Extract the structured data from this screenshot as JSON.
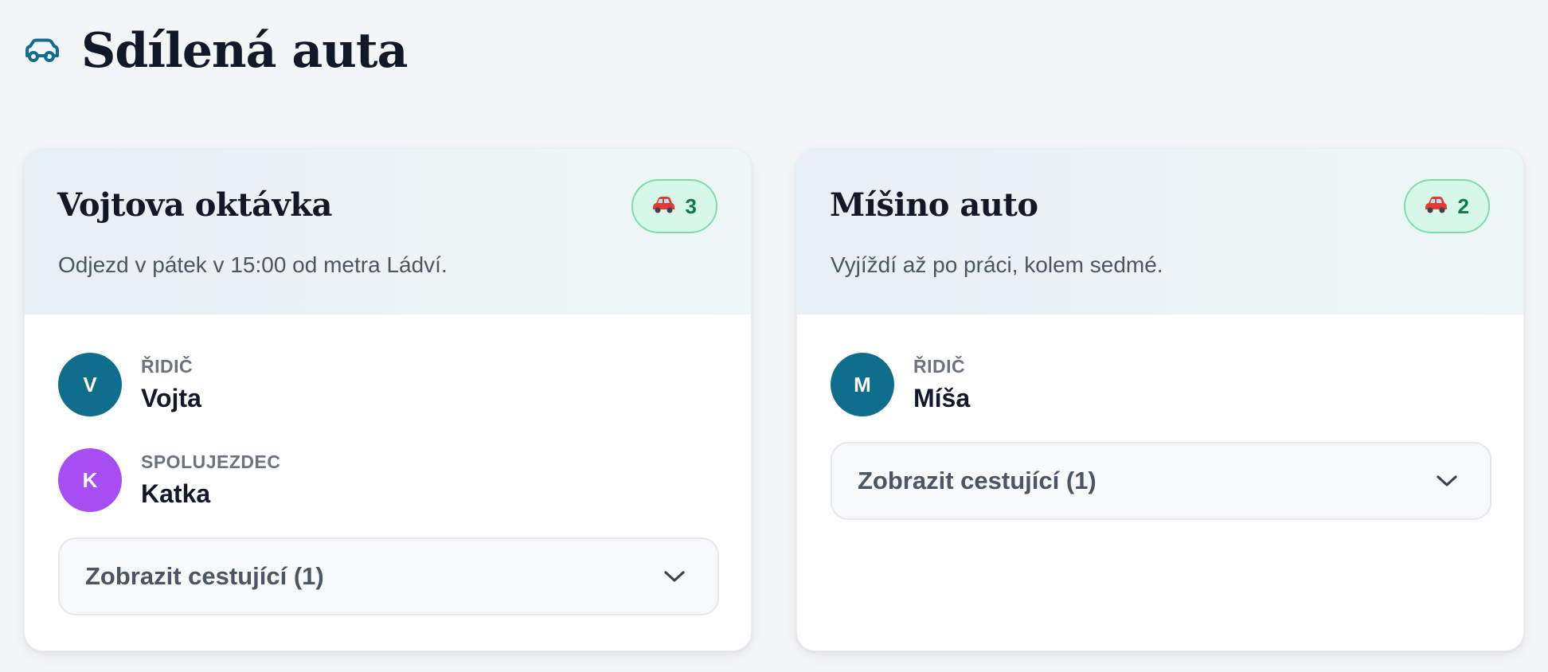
{
  "page": {
    "title": "Sdílená auta",
    "icon": "car-outline-icon",
    "accent": "#0f6e8c"
  },
  "cars": [
    {
      "title": "Vojtova oktávka",
      "description": "Odjezd v pátek v 15:00 od metra Ládví.",
      "seat_icon": "car-emoji-icon",
      "seats": "3",
      "people": [
        {
          "initial": "V",
          "role": "ŘIDIČ",
          "name": "Vojta",
          "color": "#0f6e8c"
        },
        {
          "initial": "K",
          "role": "SPOLUJEZDEC",
          "name": "Katka",
          "color": "#a64ef2"
        }
      ],
      "expand_label": "Zobrazit cestující (1)"
    },
    {
      "title": "Míšino auto",
      "description": "Vyjíždí až po práci, kolem sedmé.",
      "seat_icon": "car-emoji-icon",
      "seats": "2",
      "people": [
        {
          "initial": "M",
          "role": "ŘIDIČ",
          "name": "Míša",
          "color": "#0f6e8c"
        }
      ],
      "expand_label": "Zobrazit cestující (1)"
    }
  ]
}
